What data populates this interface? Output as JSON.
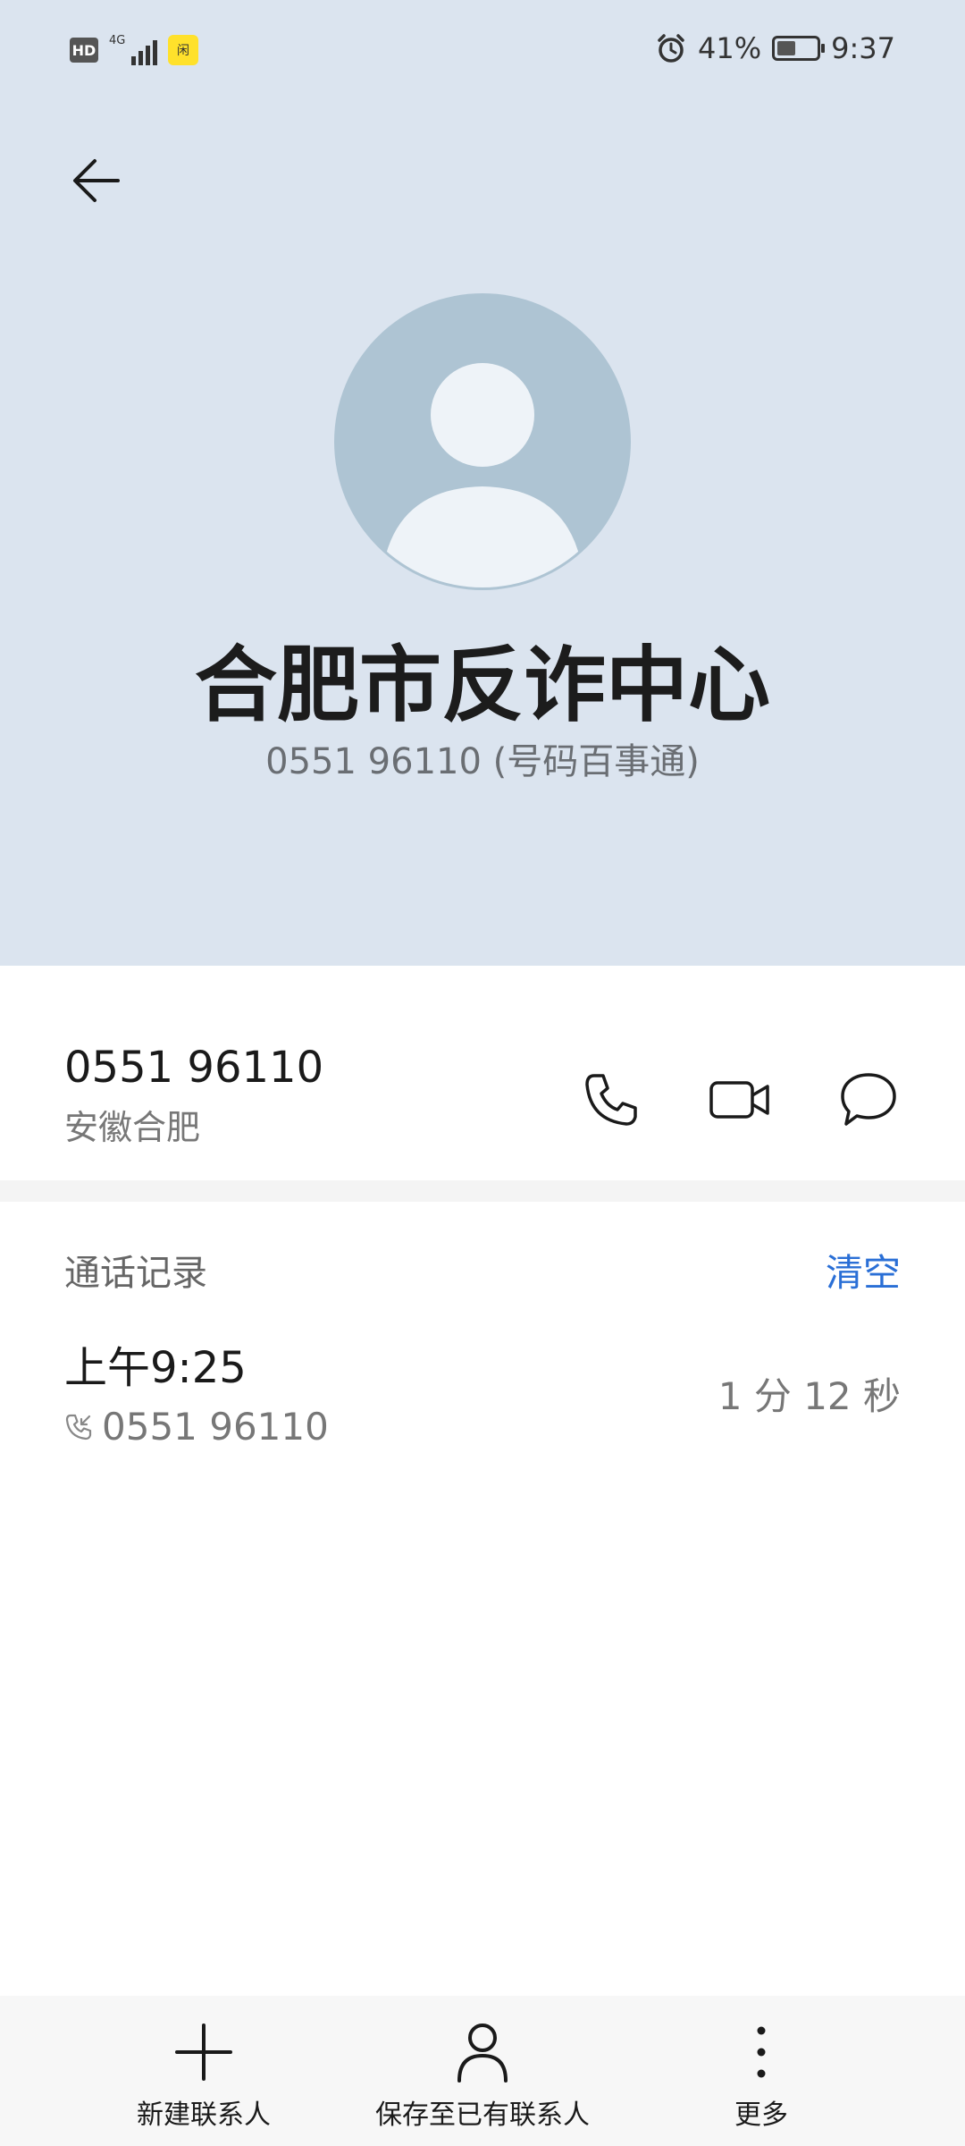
{
  "status_bar": {
    "hd_label": "HD",
    "network_label": "4G",
    "app_badge": "闲",
    "battery_percent": "41%",
    "battery_level": 0.41,
    "time": "9:37",
    "icons": [
      "hd-icon",
      "signal-icon",
      "app-notification-icon",
      "alarm-icon",
      "battery-icon"
    ]
  },
  "header": {
    "back_icon": "back-arrow-icon",
    "avatar_icon": "person-avatar-icon",
    "name": "合肥市反诈中心",
    "subtitle": "0551 96110 (号码百事通)",
    "background_color": "#dbe4ef"
  },
  "number_row": {
    "number": "0551 96110",
    "location": "安徽合肥",
    "actions": [
      {
        "icon": "phone-icon"
      },
      {
        "icon": "video-call-icon"
      },
      {
        "icon": "message-icon"
      }
    ]
  },
  "call_log": {
    "title": "通话记录",
    "clear_label": "清空",
    "accent_color": "#2a6fd6",
    "entries": [
      {
        "time": "上午9:25",
        "number": "0551 96110",
        "direction_icon": "incoming-call-icon",
        "duration": "1 分 12 秒"
      }
    ]
  },
  "bottom_bar": {
    "items": [
      {
        "label": "新建联系人",
        "icon": "plus-icon"
      },
      {
        "label": "保存至已有联系人",
        "icon": "person-icon"
      },
      {
        "label": "更多",
        "icon": "more-vertical-icon"
      }
    ]
  }
}
